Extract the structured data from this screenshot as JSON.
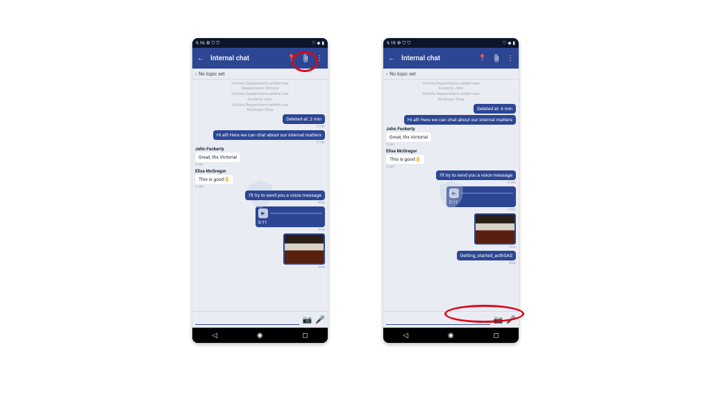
{
  "left": {
    "time": "9.16",
    "title": "Internal chat",
    "topic": "No topic set",
    "system": [
      [
        "Victoria Deppenhamn added user",
        "Deppenhamn Victoria"
      ],
      [
        "Victoria Deppenhamn added user",
        "Fockerty John"
      ],
      [
        "Victoria Deppenhamn added user",
        "McGregor Elisa"
      ]
    ],
    "msgs": {
      "del": "Deleted at: 2 min",
      "del_ts": "3 min",
      "hi": "Hi all! Here we can chat about our internal matters",
      "hi_ts": "3 min",
      "jf_name": "John Fockerty",
      "jf_text": "Great, thx Victoria!",
      "jf_ts": "2 min",
      "em_name": "Elisa McGregor",
      "em_text": "This is good👌",
      "em_ts": "1 min",
      "voice_intro": "I'll try to send you a voice message",
      "voice_intro_ts": "Now",
      "voice_dur": "0:11",
      "voice_ts": "Now",
      "img_ts": "Now"
    }
  },
  "right": {
    "time": "9.19",
    "title": "Internal chat",
    "topic": "No topic set",
    "system": [
      [
        "Victoria Deppenhamn added user",
        "Fockerty John"
      ],
      [
        "Victoria Deppenhamn added user",
        "McGregor Elisa"
      ]
    ],
    "msgs": {
      "del": "Deleted at: 6 min",
      "hi": "Hi all! Here we can chat about our internal matters",
      "jf_name": "John Fockerty",
      "jf_text": "Great, thx Victoria!",
      "jf_ts": "5 min",
      "em_name": "Elisa McGregor",
      "em_text": "This is good👌",
      "em_ts": "5 min",
      "voice_intro": "I'll try to send you a voice message",
      "voice_intro_ts": "4 min",
      "voice_dur": "0:11",
      "voice_ts": "3 min",
      "img_ts": "Now",
      "file": "Getting_started_acthSAS",
      "file_ts": "Now"
    }
  }
}
